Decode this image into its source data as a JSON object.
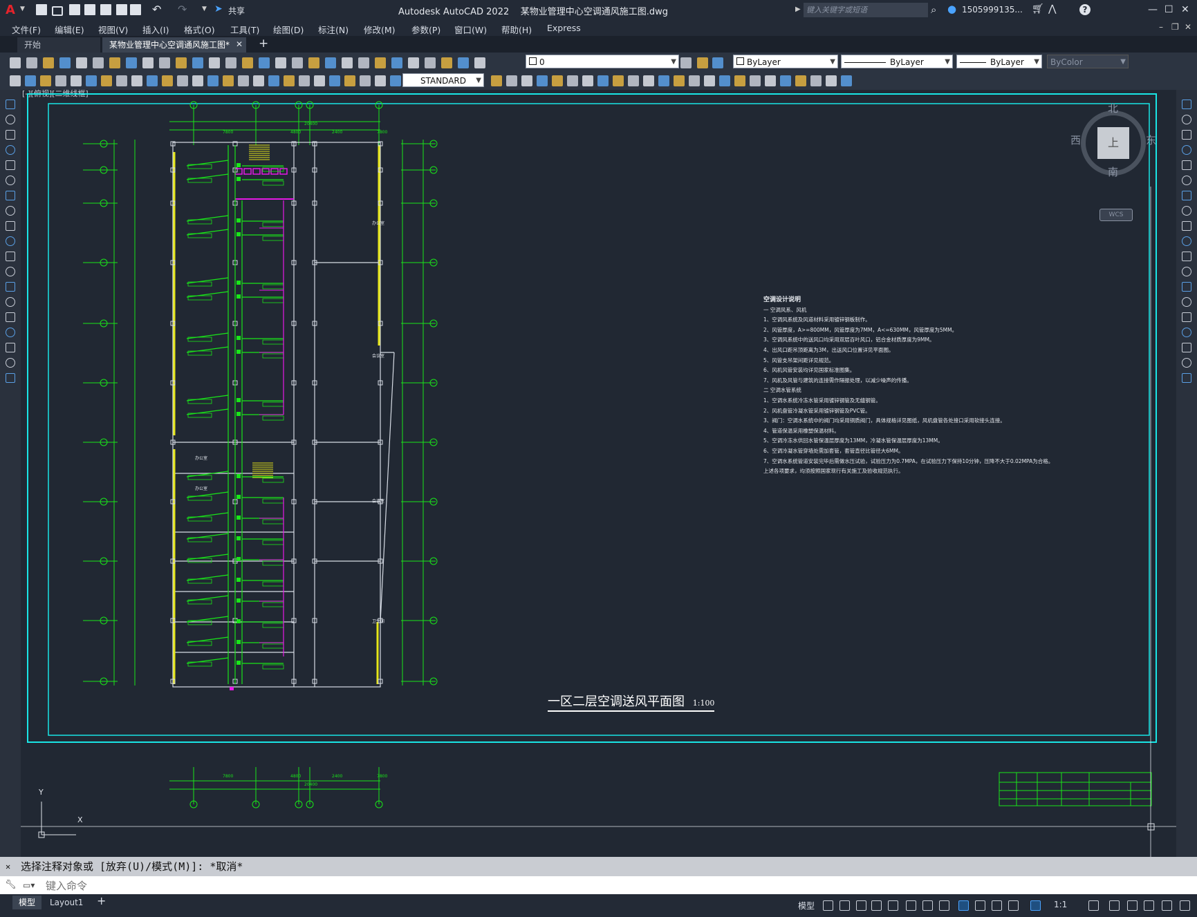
{
  "app": {
    "logo": "A",
    "title": "Autodesk AutoCAD 2022",
    "filename": "某物业管理中心空调通风施工图.dwg",
    "share_label": "共享",
    "search_placeholder": "键入关键字或短语",
    "user": "1505999135...",
    "help": "?"
  },
  "menu": [
    "文件(F)",
    "编辑(E)",
    "视图(V)",
    "插入(I)",
    "格式(O)",
    "工具(T)",
    "绘图(D)",
    "标注(N)",
    "修改(M)",
    "参数(P)",
    "窗口(W)",
    "帮助(H)",
    "Express"
  ],
  "tabs": [
    {
      "label": "开始",
      "active": false
    },
    {
      "label": "某物业管理中心空调通风施工图*",
      "active": true
    }
  ],
  "toolbar": {
    "layer_value": "0",
    "color_value": "ByLayer",
    "linetype_value": "ByLayer",
    "lineweight_value": "ByLayer",
    "plotstyle_value": "ByColor",
    "textstyle_value": "STANDARD"
  },
  "viewport": {
    "label": "[-][俯视][二维线框]",
    "viewcube_top": "上",
    "compass": {
      "north": "北",
      "south": "南",
      "east": "东",
      "west": "西"
    },
    "wcs": "WCS",
    "ucs_y": "Y",
    "ucs_x": "X"
  },
  "drawing": {
    "main_title": "一区二层空调送风平面图",
    "scale": "1:100",
    "dims_top": [
      "7800",
      "4800",
      "2400",
      "7800"
    ],
    "dims_top_total": "20400",
    "dims_bottom": [
      "7800",
      "4800",
      "2400",
      "7800"
    ],
    "dims_bottom_total": "20400",
    "notes": [
      "空调设计说明",
      "一  空调风系、风机",
      "1、空调风系统及风道材料采用镀锌钢板制作。",
      "2、风管厚度，A>=800MM，风管厚度为7MM，A<=630MM，风管厚度为5MM。",
      "3、空调风系统中的送风口均采用双层百叶风口，铝合金材质厚度为9MM。",
      "4、出风口距吊顶距离为3M，出送风口位置详见平面图。",
      "5、风管支吊架间距详见规范。",
      "6、风机风管安装均详见国家标准图集。",
      "7、风机及风管与建筑的连接需作隔振处理，以减少噪声的传播。",
      "二  空调水管系统",
      "1、空调水系统冷冻水管采用镀锌钢管及无缝钢管。",
      "2、风机盘管冷凝水管采用镀锌钢管及PVC管。",
      "3、阀门：空调水系统中的阀门均采用铜质阀门，具体规格详见图纸，风机盘管各处接口采用软接头连接。",
      "4、管道保温采用橡塑保温材料。",
      "5、空调冷冻水供回水管保温层厚度为13MM，冷凝水管保温层厚度为13MM。",
      "6、空调冷凝水管穿墙处需加套管，套管直径比管径大6MM。",
      "7、空调水系统管道安装完毕后需做水压试验，试验压力为0.7MPA，在试验压力下保持10分钟，压降不大于0.02MPA为合格。",
      "    上述各项要求，均须按照国家现行有关施工及验收规范执行。"
    ],
    "rooms": [
      "办公室",
      "会议室",
      "会议室",
      "卫生间",
      "办公室",
      "办公室"
    ]
  },
  "command": {
    "history": "选择注释对象或 [放弃(U)/模式(M)]: *取消*",
    "placeholder": "键入命令"
  },
  "layout_tabs": [
    "模型",
    "Layout1"
  ],
  "status": {
    "model_label": "模型",
    "scale": "1:1"
  },
  "colors": {
    "accent_green": "#19e619",
    "magenta": "#e619e6",
    "yellow": "#e6e619",
    "cyan": "#19e6e6",
    "wall": "#d8dde6"
  }
}
